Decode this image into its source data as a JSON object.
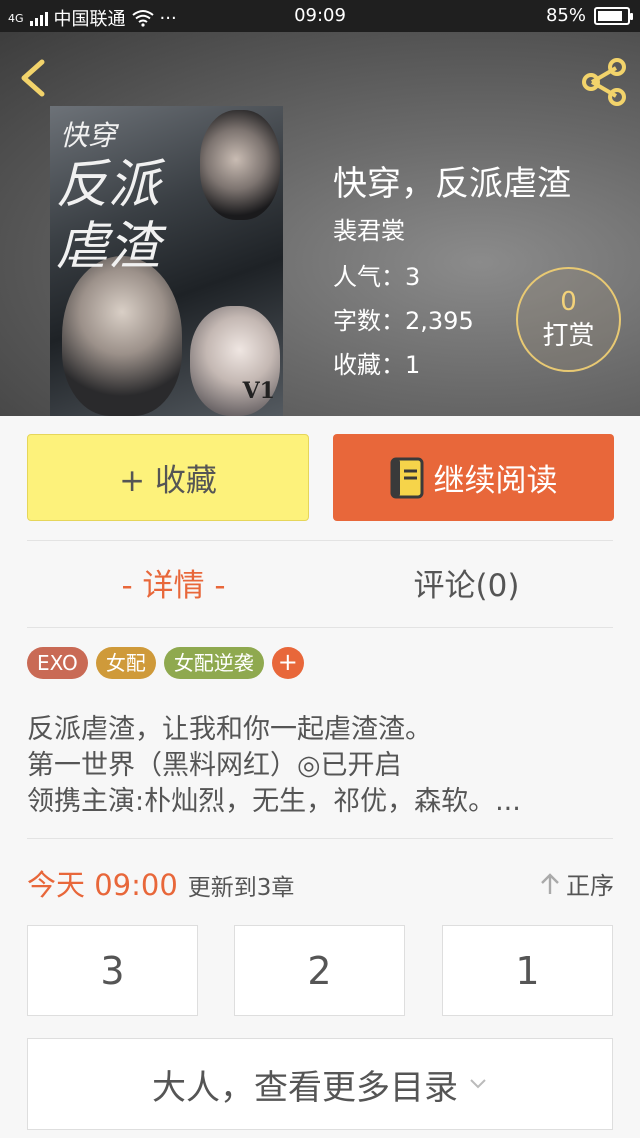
{
  "status_bar": {
    "network": "4G",
    "carrier": "中国联通",
    "more": "···",
    "time": "09:09",
    "battery_percent": "85%",
    "battery_level": 0.85
  },
  "header": {
    "back_icon": "chevron-left-icon",
    "share_icon": "share-icon"
  },
  "book": {
    "cover": {
      "title_art_top": "快穿",
      "title_art_main": "反派虐渣",
      "mark": "V1"
    },
    "title": "快穿，反派虐渣",
    "author": "裴君裳",
    "popularity_label": "人气：",
    "popularity": "3",
    "wordcount_label": "字数：",
    "wordcount": "2,395",
    "favorites_label": "收藏：",
    "favorites": "1"
  },
  "reward": {
    "count": "0",
    "label": "打赏"
  },
  "actions": {
    "collect_label": "+ 收藏",
    "read_label": "继续阅读",
    "read_icon": "book-icon"
  },
  "tabs": {
    "detail": "- 详情 -",
    "comments": "评论(0)"
  },
  "tags": [
    "EXO",
    "女配",
    "女配逆袭"
  ],
  "tag_add": "+",
  "description": [
    "反派虐渣，让我和你一起虐渣渣。",
    "第一世界（黑料网红）◎已开启",
    "领携主演:朴灿烈，无生，祁优，森软。..."
  ],
  "update": {
    "today": "今天 09:00",
    "note": "更新到3章",
    "order_label": "正序",
    "order_icon": "arrow-up-icon"
  },
  "chapters": [
    "3",
    "2",
    "1"
  ],
  "more_catalog": "大人，查看更多目录",
  "colors": {
    "accent": "#e8673a",
    "collect_bg": "#fdf27b",
    "reward_border": "#e8c973"
  }
}
